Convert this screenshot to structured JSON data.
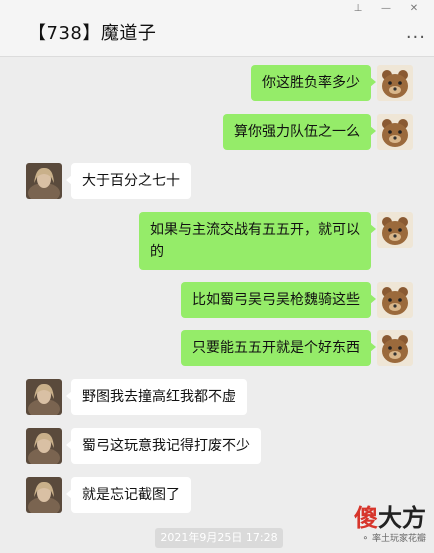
{
  "header": {
    "title": "【738】魔道子",
    "pin": "⊥",
    "minimize": "—",
    "close": "✕",
    "more": "···"
  },
  "messages": [
    {
      "side": "out",
      "text": "你这胜负率多少"
    },
    {
      "side": "out",
      "text": "算你强力队伍之一么"
    },
    {
      "side": "in",
      "text": "大于百分之七十"
    },
    {
      "side": "out",
      "text": "如果与主流交战有五五开，就可以的"
    },
    {
      "side": "out",
      "text": "比如蜀弓吴弓吴枪魏骑这些"
    },
    {
      "side": "out",
      "text": "只要能五五开就是个好东西"
    },
    {
      "side": "in",
      "text": "野图我去撞高红我都不虚"
    },
    {
      "side": "in",
      "text": "蜀弓这玩意我记得打废不少"
    },
    {
      "side": "in",
      "text": "就是忘记截图了"
    }
  ],
  "timestamp": "2021年9月25日 17:28",
  "watermark": {
    "brand_red": "傻",
    "brand_black": "大方",
    "subtitle": "率土玩家花瓣"
  },
  "colors": {
    "out_bubble": "#95ec69",
    "in_bubble": "#ffffff",
    "background": "#ededed"
  }
}
